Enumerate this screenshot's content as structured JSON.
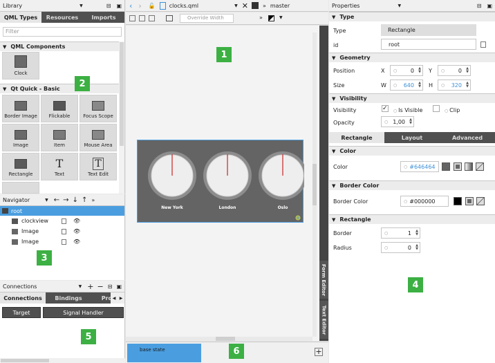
{
  "library": {
    "title": "Library",
    "tabs": [
      "QML Types",
      "Resources",
      "Imports"
    ],
    "filter_placeholder": "Filter",
    "sections": {
      "qml_components": "QML Components",
      "qt_quick_basic": "Qt Quick - Basic"
    },
    "items": {
      "clock": "Clock",
      "border_image": "Border Image",
      "flickable": "Flickable",
      "focus_scope": "Focus Scope",
      "image": "Image",
      "item": "Item",
      "mouse_area": "Mouse Area",
      "rectangle": "Rectangle",
      "text": "Text",
      "text_edit": "Text Edit"
    }
  },
  "navigator": {
    "title": "Navigator",
    "tree": [
      "root",
      "clockview",
      "Image",
      "Image"
    ]
  },
  "connections": {
    "title": "Connections",
    "tabs": [
      "Connections",
      "Bindings",
      "Pro"
    ],
    "columns": [
      "Target",
      "Signal Handler"
    ]
  },
  "editor": {
    "file_name": "clocks.qml",
    "branch": "master",
    "override_width": "Override Width",
    "clocks": [
      "New York",
      "London",
      "Oslo"
    ],
    "side_tabs": [
      "Form Editor",
      "Text Editor"
    ],
    "state": "base state"
  },
  "properties": {
    "title": "Properties",
    "type_section": "Type",
    "type_label": "Type",
    "type_value": "Rectangle",
    "id_label": "id",
    "id_value": "root",
    "geometry_section": "Geometry",
    "position_label": "Position",
    "x_label": "X",
    "x_value": "0",
    "y_label": "Y",
    "y_value": "0",
    "size_label": "Size",
    "w_label": "W",
    "w_value": "640",
    "h_label": "H",
    "h_value": "320",
    "visibility_section": "Visibility",
    "visibility_label": "Visibility",
    "is_visible": "Is Visible",
    "clip": "Clip",
    "opacity_label": "Opacity",
    "opacity_value": "1,00",
    "tabs": [
      "Rectangle",
      "Layout",
      "Advanced"
    ],
    "color_section": "Color",
    "color_label": "Color",
    "color_value": "#646464",
    "border_color_section": "Border Color",
    "border_color_label": "Border Color",
    "border_color_value": "#000000",
    "rectangle_section": "Rectangle",
    "border_label": "Border",
    "border_value": "1",
    "radius_label": "Radius",
    "radius_value": "0"
  },
  "badges": [
    "1",
    "2",
    "3",
    "4",
    "5",
    "6"
  ],
  "colors": {
    "badge": "#3cb043",
    "selection": "#4a9ee0",
    "canvas": "#646464"
  }
}
